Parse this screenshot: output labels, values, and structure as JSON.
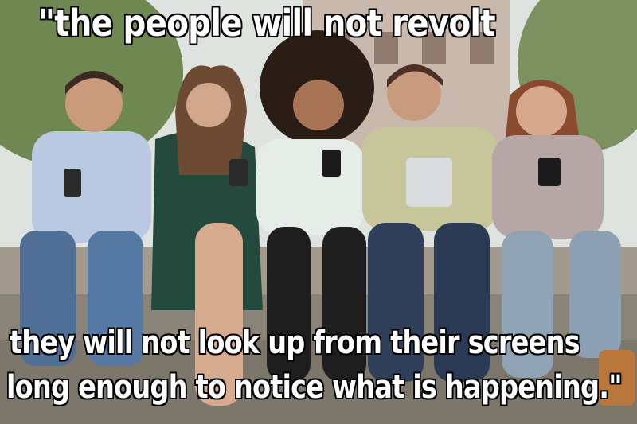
{
  "meme": {
    "top_text": "\"the people will not revolt",
    "bottom_line_1": "they will not look up from their screens",
    "bottom_line_2": "long enough to notice what is happening.\""
  },
  "photo": {
    "subject": "five young adults sitting on steps looking at phones and a tablet",
    "colors": {
      "sky": "#e9eef0",
      "steps": "#8d857a",
      "denim": "#4f6f96",
      "foliage": "#5e7a45"
    }
  }
}
